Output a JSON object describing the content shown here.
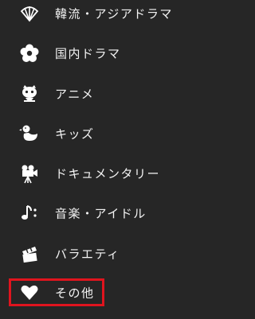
{
  "menu": {
    "items": [
      {
        "label": "韓流・アジアドラマ",
        "icon": "fan-icon"
      },
      {
        "label": "国内ドラマ",
        "icon": "flower-icon"
      },
      {
        "label": "アニメ",
        "icon": "cute-character-icon"
      },
      {
        "label": "キッズ",
        "icon": "duck-icon"
      },
      {
        "label": "ドキュメンタリー",
        "icon": "movie-camera-icon"
      },
      {
        "label": "音楽・アイドル",
        "icon": "music-note-icon"
      },
      {
        "label": "バラエティ",
        "icon": "clapperboard-icon"
      },
      {
        "label": "その他",
        "icon": "heart-icon",
        "selected": true
      }
    ]
  },
  "colors": {
    "background": "#262626",
    "text": "#f4f4f4",
    "highlight_border": "#e0141e"
  }
}
